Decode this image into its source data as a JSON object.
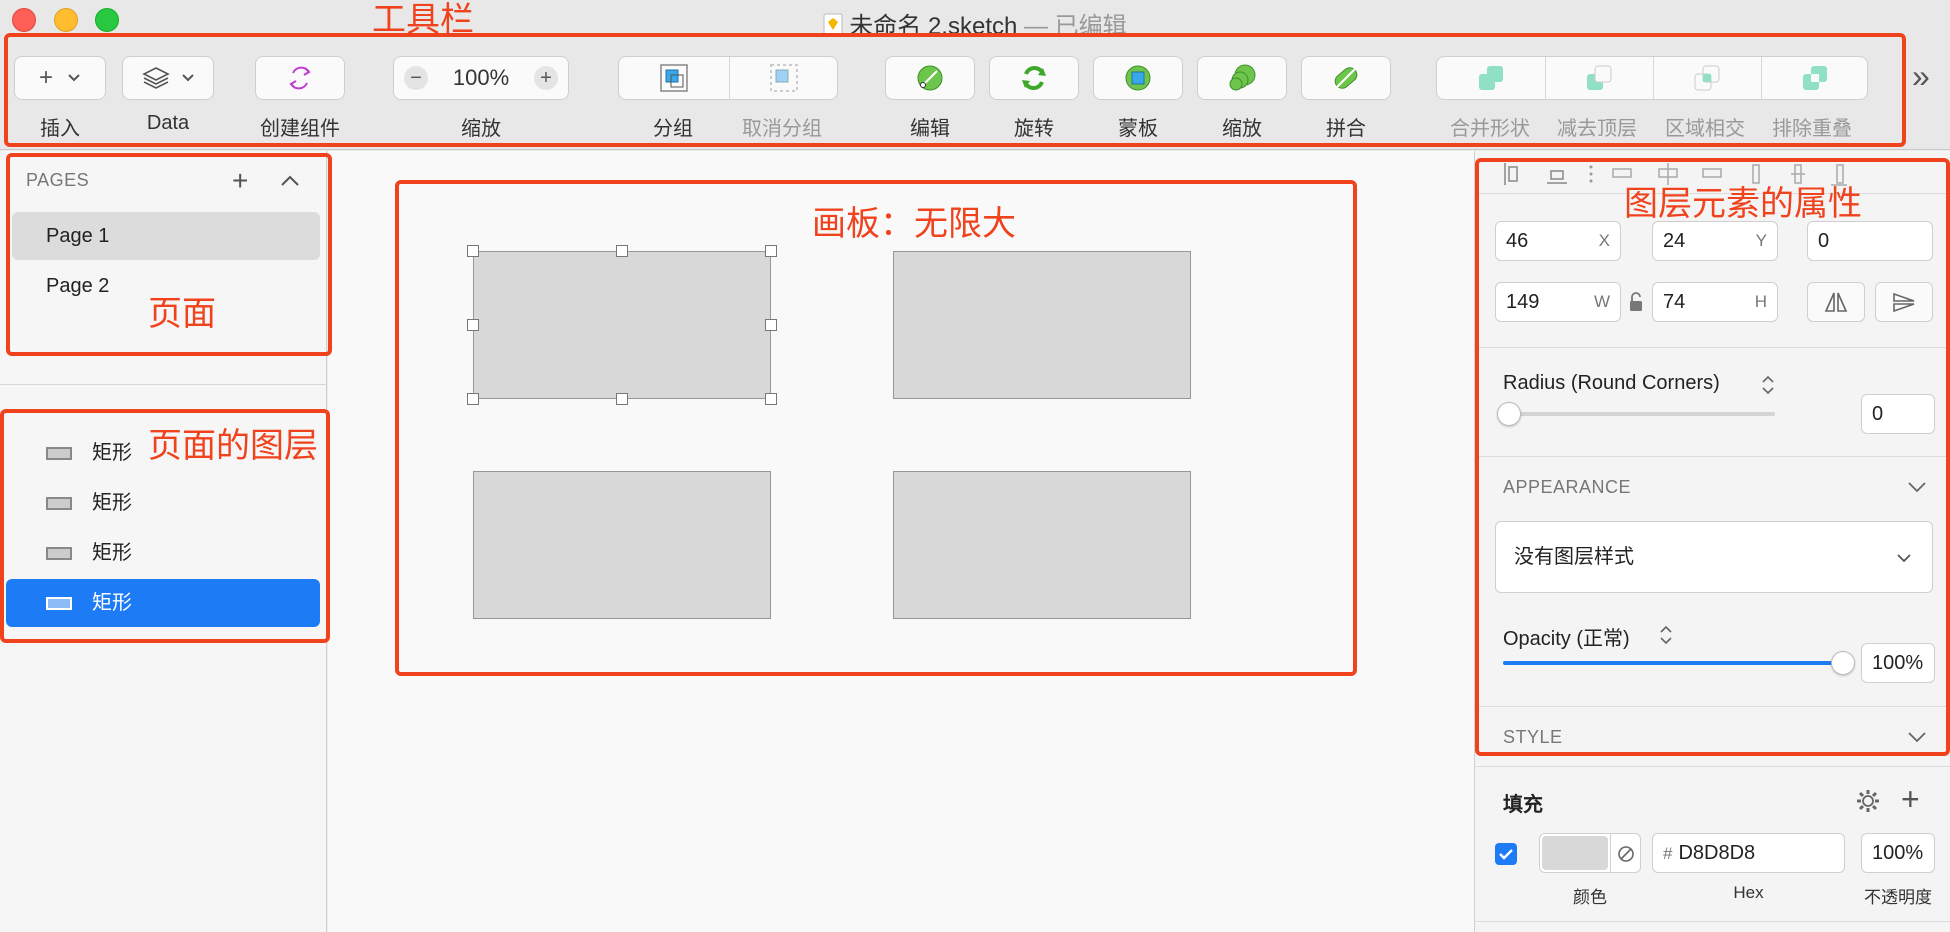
{
  "window": {
    "title": "未命名 2.sketch",
    "edited": " — 已编辑",
    "colors": {
      "close": "#fe5f57",
      "minimize": "#febc2e",
      "zoom": "#28c840"
    }
  },
  "toolbar": {
    "insert_label": "插入",
    "data_label": "Data",
    "create_symbol_label": "创建组件",
    "zoom_value": "100%",
    "zoom_label": "缩放",
    "group_label": "分组",
    "ungroup_label": "取消分组",
    "edit_label": "编辑",
    "rotate_label": "旋转",
    "mask_label": "蒙板",
    "scale_label": "缩放",
    "flatten_label": "拼合",
    "union_label": "合并形状",
    "subtract_label": "减去顶层",
    "intersect_label": "区域相交",
    "difference_label": "排除重叠",
    "overflow_glyph": "»"
  },
  "pages": {
    "header": "PAGES",
    "items": [
      {
        "label": "Page 1",
        "selected": true
      },
      {
        "label": "Page 2",
        "selected": false
      }
    ]
  },
  "layers": {
    "items": [
      {
        "label": "矩形",
        "selected": false
      },
      {
        "label": "矩形",
        "selected": false
      },
      {
        "label": "矩形",
        "selected": false
      },
      {
        "label": "矩形",
        "selected": true
      }
    ]
  },
  "inspector": {
    "x": "46",
    "x_label": "X",
    "y": "24",
    "y_label": "Y",
    "rotation": "0",
    "w": "149",
    "w_label": "W",
    "h": "74",
    "h_label": "H",
    "radius_label": "Radius (Round Corners)",
    "radius_value": "0",
    "appearance_header": "APPEARANCE",
    "layer_style": "没有图层样式",
    "opacity_label": "Opacity (正常)",
    "opacity_value": "100%",
    "opacity_fraction": 1.0,
    "style_header": "STYLE",
    "fill_label": "填充",
    "fill_hex": "D8D8D8",
    "fill_hash": "#",
    "fill_opacity": "100%",
    "fill_color_caption": "颜色",
    "fill_hex_caption": "Hex",
    "fill_opacity_caption": "不透明度",
    "fill_color": "#D8D8D8"
  },
  "annotations": {
    "toolbar": "工具栏",
    "pages": "页面",
    "layers": "页面的图层",
    "canvas": "画板：无限大",
    "inspector": "图层元素的属性",
    "color": "#f0421c"
  },
  "accent_color": "#1d7bf5"
}
